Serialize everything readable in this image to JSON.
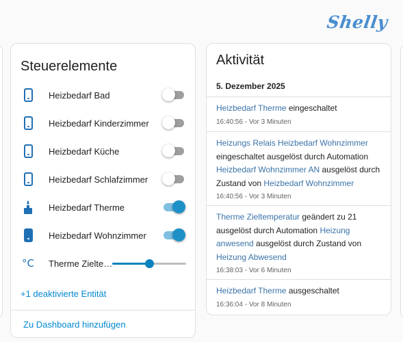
{
  "brand": {
    "logo_text": "Shelly"
  },
  "controls": {
    "title": "Steuerelemente",
    "items": [
      {
        "label": "Heizbedarf Bad",
        "icon": "phone-outline-icon",
        "state": "off"
      },
      {
        "label": "Heizbedarf Kinderzimmer",
        "icon": "phone-outline-icon",
        "state": "off"
      },
      {
        "label": "Heizbedarf Küche",
        "icon": "phone-outline-icon",
        "state": "off"
      },
      {
        "label": "Heizbedarf Schlafzimmer",
        "icon": "phone-outline-icon",
        "state": "off"
      },
      {
        "label": "Heizbedarf Therme",
        "icon": "water-boiler-icon",
        "state": "on"
      },
      {
        "label": "Heizbedarf Wohnzimmer",
        "icon": "phone-filled-icon",
        "state": "on"
      }
    ],
    "slider": {
      "icon_text": "°C",
      "label": "Therme Zielte…",
      "value_fraction": 0.5
    },
    "deactivated_link": "+1 deaktivierte Entität",
    "add_dashboard": "Zu Dashboard hinzufügen"
  },
  "activity": {
    "title": "Aktivität",
    "date": "5. Dezember 2025",
    "entries": [
      {
        "parts": [
          {
            "text": "Heizbedarf Therme",
            "link": true
          },
          {
            "text": " eingeschaltet",
            "link": false
          }
        ],
        "time": "16:40:56 - Vor 3 Minuten"
      },
      {
        "parts": [
          {
            "text": "Heizungs Relais Heizbedarf Wohnzimmer",
            "link": true
          },
          {
            "text": " eingeschaltet ausgelöst durch Automation ",
            "link": false
          },
          {
            "text": "Heizbedarf Wohnzimmer AN",
            "link": true
          },
          {
            "text": " ausgelöst durch Zustand von ",
            "link": false
          },
          {
            "text": "Heizbedarf Wohnzimmer",
            "link": true
          }
        ],
        "time": "16:40:56 - Vor 3 Minuten"
      },
      {
        "parts": [
          {
            "text": "Therme Zieltemperatur",
            "link": true
          },
          {
            "text": " geändert zu 21 ausgelöst durch Automation ",
            "link": false
          },
          {
            "text": "Heizung anwesend",
            "link": true
          },
          {
            "text": " ausgelöst durch Zustand von ",
            "link": false
          },
          {
            "text": "Heizung Abwesend",
            "link": true
          }
        ],
        "time": "16:38:03 - Vor 6 Minuten"
      },
      {
        "parts": [
          {
            "text": "Heizbedarf Therme",
            "link": true
          },
          {
            "text": " ausgeschaltet",
            "link": false
          }
        ],
        "time": "16:36:04 - Vor 8 Minuten"
      }
    ]
  },
  "colors": {
    "accent": "#0288d1",
    "link": "#3a73a8",
    "icon": "#1f6fb4",
    "toggle_on": "#1e90c8",
    "toggle_off": "#9e9e9e"
  }
}
